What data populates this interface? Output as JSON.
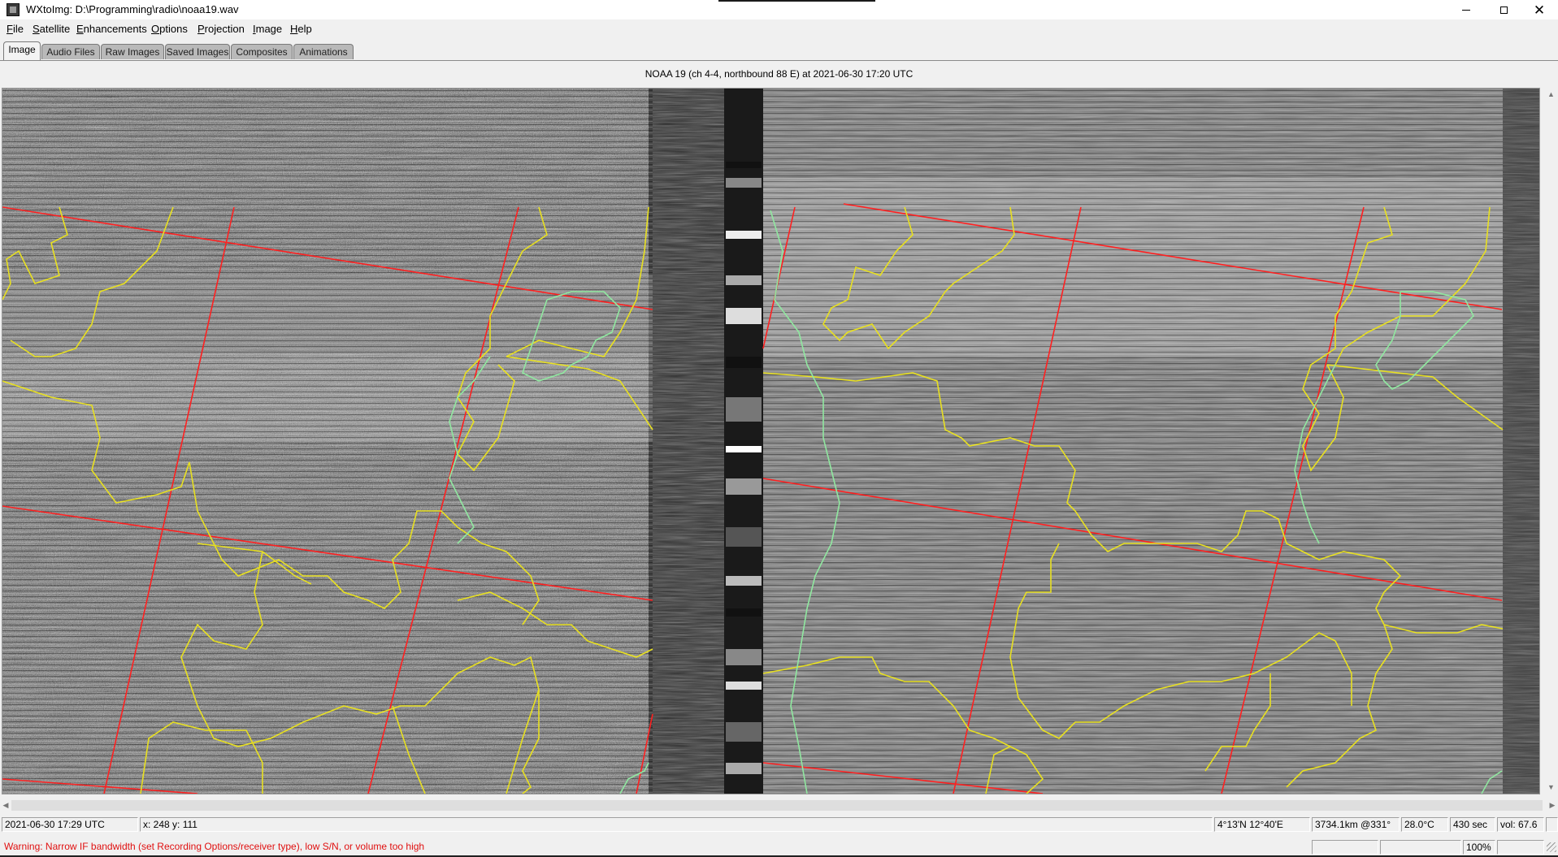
{
  "window": {
    "title": "WXtoImg: D:\\Programming\\radio\\noaa19.wav",
    "icon": "wxtoimg-app-icon",
    "controls": {
      "minimize_icon": "minimize-icon",
      "maximize_icon": "maximize-icon",
      "close_icon": "close-icon",
      "close_glyph": "✕"
    }
  },
  "menu": [
    "File",
    "Satellite",
    "Enhancements",
    "Options",
    "Projection",
    "Image",
    "Help"
  ],
  "tabs": [
    {
      "label": "Image",
      "active": true
    },
    {
      "label": "Audio Files",
      "active": false
    },
    {
      "label": "Raw Images",
      "active": false
    },
    {
      "label": "Saved Images",
      "active": false
    },
    {
      "label": "Composites",
      "active": false
    },
    {
      "label": "Animations",
      "active": false
    }
  ],
  "image_heading": "NOAA 19 (ch 4-4, northbound 88 E) at 2021-06-30  17:20 UTC",
  "image": {
    "description_icon": "satellite-image",
    "colors": {
      "grid": "#ff2020",
      "borders": "#e8e020",
      "coast": "#90e8a0"
    }
  },
  "scrollbars": {
    "up_arrow": "▲",
    "down_arrow": "▼",
    "left_arrow": "◀",
    "right_arrow": "▶"
  },
  "status": {
    "datetime": "2021-06-30  17:29 UTC",
    "cursor": "x: 248  y: 111",
    "latlon": "4°13'N 12°40'E",
    "distance": "3734.1km @331°",
    "temperature": "28.0°C",
    "duration": "430 sec",
    "volume": "vol: 67.6",
    "warning": "Warning: Narrow IF bandwidth (set Recording Options/receiver type), low S/N, or volume too high",
    "zoom": "100%"
  }
}
